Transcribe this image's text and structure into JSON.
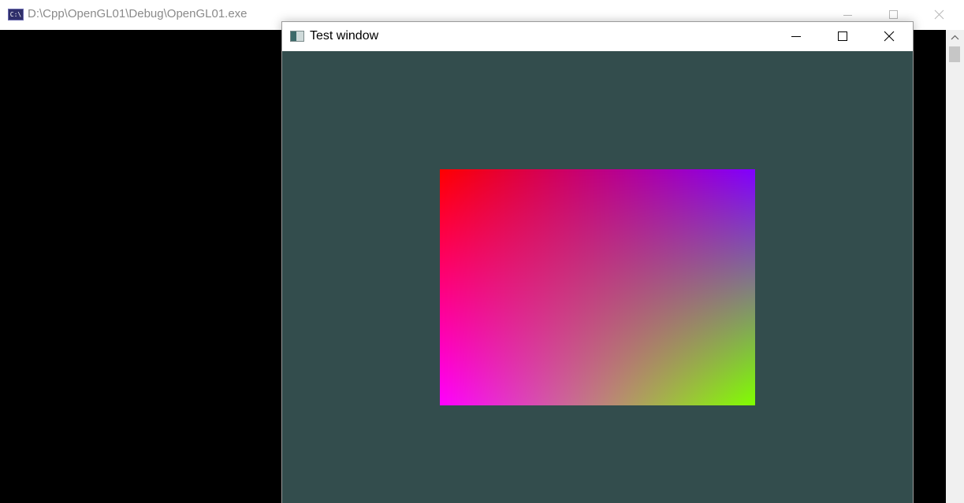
{
  "console_window": {
    "title": "D:\\Cpp\\OpenGL01\\Debug\\OpenGL01.exe",
    "icon_text": "C:\\",
    "icon": "console-app-icon",
    "controls": {
      "minimize_icon": "minimize-icon",
      "maximize_icon": "maximize-icon",
      "close_icon": "close-icon"
    },
    "body_color": "#000000",
    "scrollbar": {
      "up_icon": "chevron-up-icon"
    }
  },
  "test_window": {
    "title": "Test window",
    "icon": "app-window-icon",
    "controls": {
      "minimize_icon": "minimize-icon",
      "maximize_icon": "maximize-icon",
      "close_icon": "close-icon"
    },
    "clear_color": "#334d4d",
    "quad": {
      "corner_colors": {
        "top_left": "#ff0000",
        "top_right": "#8000ff",
        "bottom_left": "#ff00ff",
        "bottom_right": "#80ff00"
      }
    }
  }
}
